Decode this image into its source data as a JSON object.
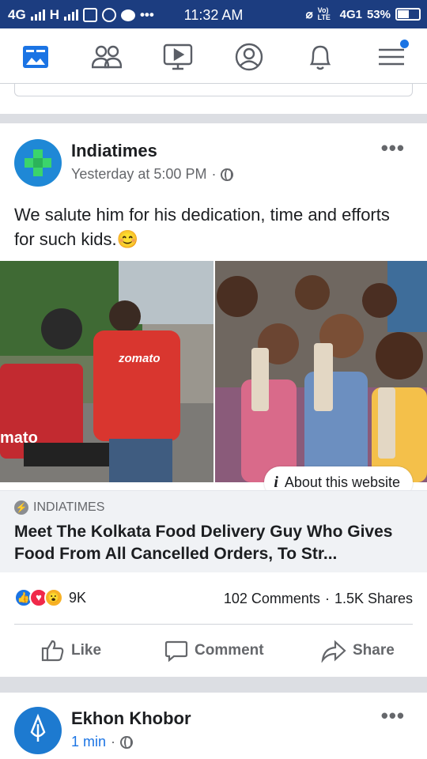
{
  "status_bar": {
    "network_left": "4G",
    "network_h": "H",
    "time": "11:32 AM",
    "volte": "Vo) LTE",
    "network_right": "4G1",
    "battery": "53%"
  },
  "nav": {
    "items": [
      "news-feed",
      "friends",
      "watch",
      "profile",
      "notifications",
      "menu"
    ],
    "accent": "#1b74e4"
  },
  "post": {
    "page_name": "Indiatimes",
    "timestamp": "Yesterday at 5:00 PM",
    "separator": "·",
    "text": "We salute him for his dedication, time and efforts for such kids.😊",
    "about_label": "About this website",
    "link": {
      "source": "INDIATIMES",
      "headline": "Meet The Kolkata Food Delivery Guy Who Gives Food From All Cancelled Orders, To Str..."
    },
    "image_text": {
      "brand_shirt": "zomato",
      "bag": "mato"
    },
    "reactions": {
      "count": "9K",
      "comments": "102 Comments",
      "dot": "·",
      "shares": "1.5K Shares"
    },
    "actions": {
      "like": "Like",
      "comment": "Comment",
      "share": "Share"
    }
  },
  "next_post": {
    "page_name": "Ekhon Khobor",
    "timestamp": "1 min",
    "separator": "·"
  }
}
